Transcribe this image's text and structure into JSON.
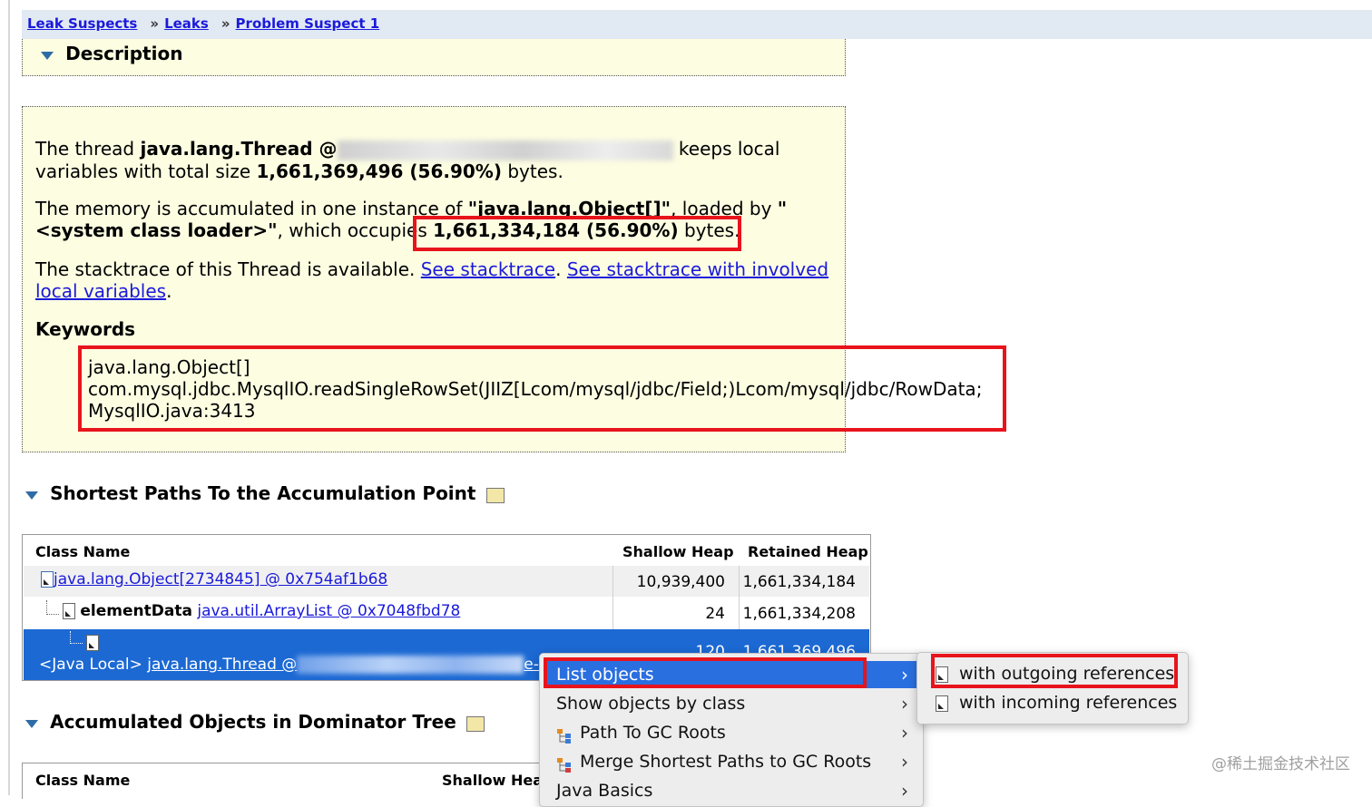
{
  "breadcrumb": {
    "items": [
      "Leak Suspects",
      "Leaks",
      "Problem Suspect 1"
    ],
    "separator": "»"
  },
  "description": {
    "title": "Description",
    "thread_prefix": "The thread ",
    "thread_class": "java.lang.Thread @",
    "thread_suffix": " keeps local",
    "line2_prefix": "variables with total size ",
    "total_size": "1,661,369,496 (56.90%)",
    "line2_suffix": " bytes.",
    "mem_prefix": "The memory is accumulated in one instance of ",
    "mem_class": "\"java.lang.Object[]\"",
    "mem_loaded": ", loaded by ",
    "mem_quote": "\"",
    "mem_loader": "<system class loader>\"",
    "mem_occupies": ", which occupies ",
    "occupied": "1,661,334,184 (56.90%)",
    "mem_suffix": " bytes.",
    "stack_prefix": "The stacktrace of this Thread is available. ",
    "stack_link1": "See stacktrace",
    "stack_mid": ". ",
    "stack_link2a": "See stacktrace with involved",
    "stack_link2b": "local variables",
    "stack_end": ".",
    "keywords_title": "Keywords",
    "keywords": [
      "java.lang.Object[]",
      "com.mysql.jdbc.MysqlIO.readSingleRowSet(JIIZ[Lcom/mysql/jdbc/Field;)Lcom/mysql/jdbc/RowData;",
      "MysqlIO.java:3413"
    ]
  },
  "shortest_paths": {
    "title": "Shortest Paths To the Accumulation Point",
    "columns": [
      "Class Name",
      "Shallow Heap",
      "Retained Heap"
    ],
    "rows": [
      {
        "prefix": "",
        "link": "java.lang.Object[2734845] @ 0x754af1b68",
        "shallow": "10,939,400",
        "retained": "1,661,334,184"
      },
      {
        "prefix": "elementData",
        "link": "java.util.ArrayList @ 0x7048fbd78",
        "shallow": "24",
        "retained": "1,661,334,208"
      },
      {
        "prefix": "<Java Local>",
        "link": "java.lang.Thread @",
        "link_tail": "e-63",
        "shallow": "120",
        "retained": "1,661,369,496"
      }
    ]
  },
  "dominator": {
    "title": "Accumulated Objects in Dominator Tree",
    "columns": [
      "Class Name",
      "Shallow Heap"
    ]
  },
  "context_menu": {
    "items": [
      {
        "label": "List objects",
        "icon": "",
        "submenu": true
      },
      {
        "label": "Show objects by class",
        "icon": "",
        "submenu": true
      },
      {
        "label": "Path To GC Roots",
        "icon": "path-gc-icon",
        "submenu": true
      },
      {
        "label": "Merge Shortest Paths to GC Roots",
        "icon": "merge-paths-icon",
        "submenu": true
      },
      {
        "label": "Java Basics",
        "icon": "",
        "submenu": true
      }
    ],
    "chevron": "›"
  },
  "submenu": {
    "items": [
      {
        "label": "with outgoing references",
        "icon": "outgoing-refs-icon"
      },
      {
        "label": "with incoming references",
        "icon": "incoming-refs-icon"
      }
    ]
  },
  "watermark": "@稀土掘金技术社区",
  "colors": {
    "accent": "#1c69d3",
    "menu_highlight": "#2a6fe0",
    "annotation_red": "#e8141c",
    "description_bg": "#fdfde2",
    "breadcrumb_bg": "#e1e9f3",
    "link": "#1a1adb"
  }
}
